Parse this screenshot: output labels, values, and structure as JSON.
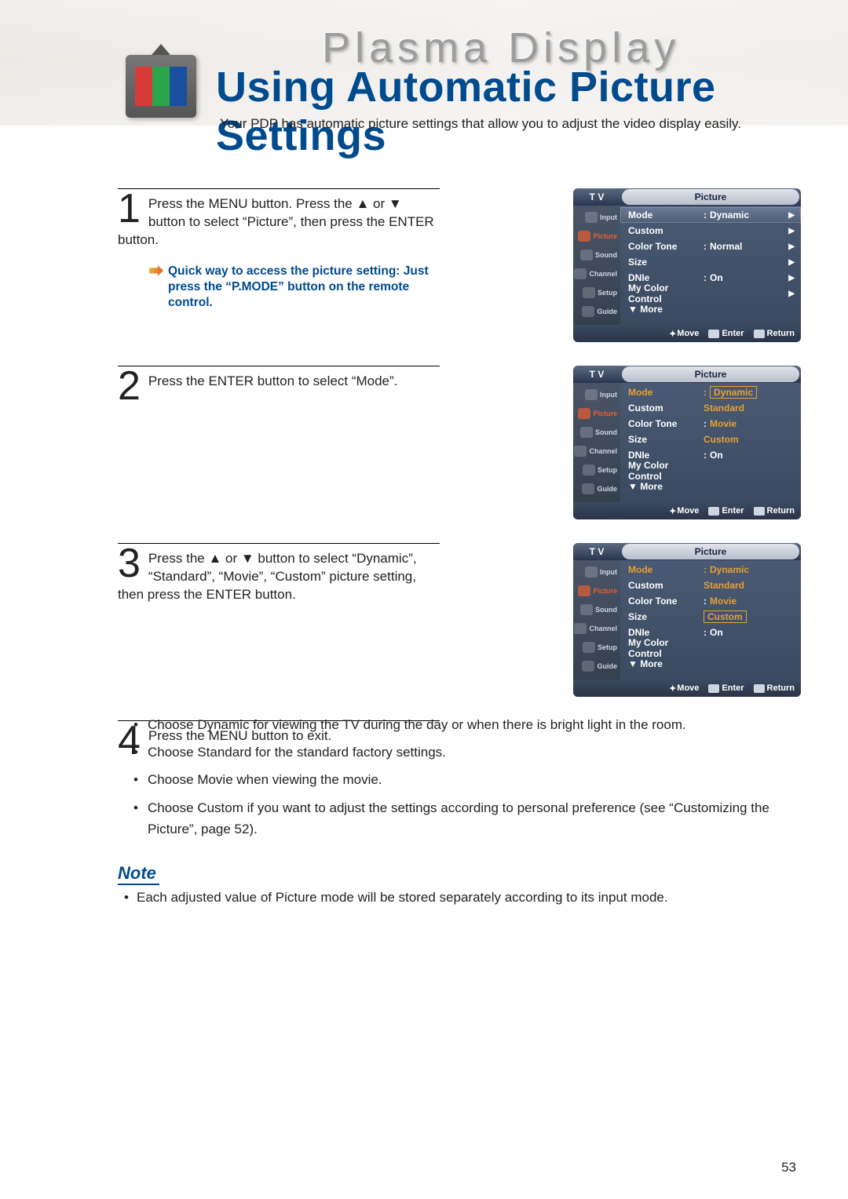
{
  "header": {
    "brand": "Plasma Display",
    "title": "Using Automatic Picture Settings",
    "intro": "Your PDP has automatic picture settings that allow you to adjust the video display easily."
  },
  "steps": [
    {
      "num": "1",
      "text": "Press the MENU button. Press the ▲ or ▼ button to select “Picture”, then press the ENTER button.",
      "tip": "Quick way to access the picture setting: Just press the “P.MODE” button on the remote control."
    },
    {
      "num": "2",
      "text": "Press the ENTER button to select “Mode”."
    },
    {
      "num": "3",
      "text": "Press the ▲ or ▼ button to select “Dynamic”, “Standard”, “Movie”, “Custom” picture setting, then press the ENTER button."
    },
    {
      "num": "4",
      "text": "Press the MENU button to exit."
    }
  ],
  "osd": {
    "tv_label": "T V",
    "section": "Picture",
    "sidebar": [
      "Input",
      "Picture",
      "Sound",
      "Channel",
      "Setup",
      "Guide"
    ],
    "rows": [
      {
        "label": "Mode",
        "value": "Dynamic",
        "arrow": true
      },
      {
        "label": "Custom",
        "value": "",
        "arrow": true
      },
      {
        "label": "Color Tone",
        "value": "Normal",
        "arrow": true
      },
      {
        "label": "Size",
        "value": "",
        "arrow": true
      },
      {
        "label": "DNIe",
        "value": "On",
        "arrow": true
      },
      {
        "label": "My Color Control",
        "value": "",
        "arrow": true
      },
      {
        "label": "▼ More",
        "value": "",
        "arrow": false
      }
    ],
    "mode_options": [
      "Dynamic",
      "Standard",
      "Movie",
      "Custom"
    ],
    "footer": {
      "move": "Move",
      "enter": "Enter",
      "return": "Return"
    }
  },
  "bullets": [
    "Choose Dynamic for viewing the TV during the day or when there is bright light in the room.",
    "Choose Standard for the standard factory settings.",
    "Choose Movie when viewing the movie.",
    "Choose Custom if you want to adjust the settings according to personal preference (see “Customizing the Picture”, page 52)."
  ],
  "note": {
    "title": "Note",
    "items": [
      "Each adjusted value of Picture mode will be stored separately according to its input mode."
    ]
  },
  "page_number": "53"
}
